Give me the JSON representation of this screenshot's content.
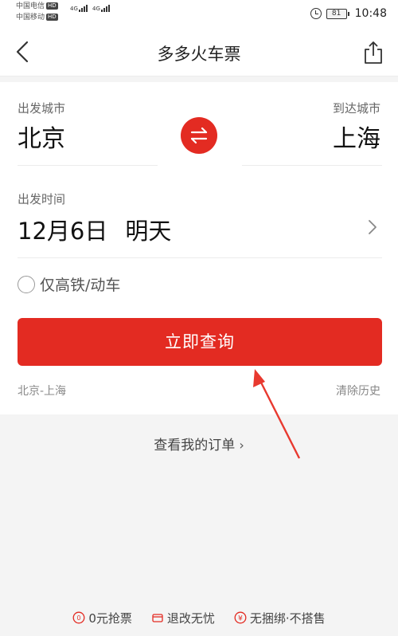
{
  "status_bar": {
    "carrier_1": "中国电信",
    "carrier_2": "中国移动",
    "hd": "HD",
    "network": "4G",
    "battery": "81",
    "time": "10:48",
    "icons": [
      "alarm-icon",
      "battery-icon",
      "signal-icon"
    ]
  },
  "nav": {
    "title": "多多火车票",
    "back_icon": "chevron-left-icon",
    "share_icon": "share-icon"
  },
  "search_form": {
    "depart_label": "出发城市",
    "depart_city": "北京",
    "arrive_label": "到达城市",
    "arrive_city": "上海",
    "swap_icon": "swap-arrows-icon",
    "date_label": "出发时间",
    "date": "12月6日",
    "date_relative": "明天",
    "filter_label": "仅高铁/动车",
    "filter_checked": false,
    "search_button": "立即查询",
    "history_item": "北京-上海",
    "clear_history": "清除历史"
  },
  "my_orders": "查看我的订单",
  "footer": [
    {
      "icon": "zero-coin-icon",
      "label": "0元抢票"
    },
    {
      "icon": "wallet-icon",
      "label": "退改无忧"
    },
    {
      "icon": "yuan-coin-icon",
      "label": "无捆绑·不搭售"
    }
  ],
  "colors": {
    "accent": "#e32b22",
    "annotation_arrow": "#e8392f",
    "background": "#f4f4f4"
  }
}
